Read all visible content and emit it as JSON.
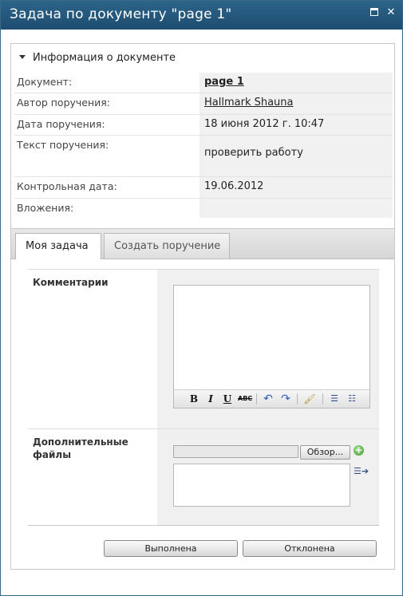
{
  "window": {
    "title": "Задача по документу \"page 1\""
  },
  "info": {
    "header": "Информация о документе",
    "rows": [
      {
        "label": "Документ:",
        "value": "page 1"
      },
      {
        "label": "Автор поручения:",
        "value": "Hallmark Shauna"
      },
      {
        "label": "Дата поручения:",
        "value": "18 июня 2012 г. 10:47"
      },
      {
        "label": "Текст поручения:",
        "value": "проверить работу"
      },
      {
        "label": "Контрольная дата:",
        "value": "19.06.2012"
      },
      {
        "label": "Вложения:",
        "value": ""
      }
    ]
  },
  "tabs": [
    {
      "label": "Моя задача",
      "active": true
    },
    {
      "label": "Создать поручение",
      "active": false
    }
  ],
  "form": {
    "comments_label": "Комментарии",
    "comments_value": "",
    "toolbar": {
      "bold": "B",
      "italic": "I",
      "underline": "U",
      "strike": "ABC",
      "undo": "↶",
      "redo": "↷",
      "clear": "🖌",
      "bullets": "☰",
      "numbering": "☷"
    },
    "files_label": "Дополнительные файлы",
    "file_value": "",
    "browse_label": "Обзор..."
  },
  "buttons": {
    "done": "Выполнена",
    "reject": "Отклонена"
  },
  "icons": {
    "maximize": "maximize-icon",
    "close": "close-icon",
    "collapse": "triangle-down-icon",
    "add": "add-file-icon",
    "attach": "attach-list-icon"
  }
}
